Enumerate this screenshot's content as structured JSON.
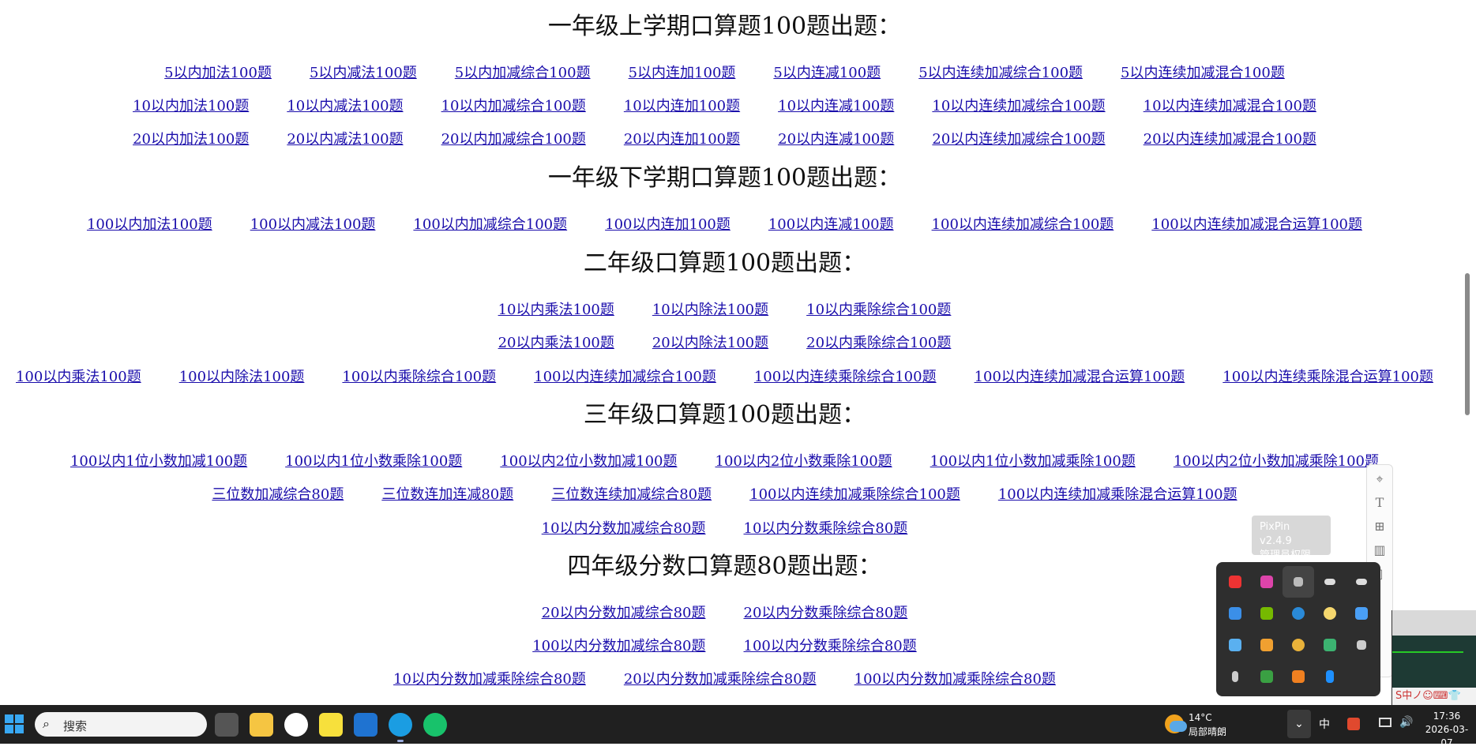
{
  "sections": [
    {
      "title": "一年级上学期口算题100题出题：",
      "rows": [
        [
          "5以内加法100题",
          "5以内减法100题",
          "5以内加减综合100题",
          "5以内连加100题",
          "5以内连减100题",
          "5以内连续加减综合100题",
          "5以内连续加减混合100题"
        ],
        [
          "10以内加法100题",
          "10以内减法100题",
          "10以内加减综合100题",
          "10以内连加100题",
          "10以内连减100题",
          "10以内连续加减综合100题",
          "10以内连续加减混合100题"
        ],
        [
          "20以内加法100题",
          "20以内减法100题",
          "20以内加减综合100题",
          "20以内连加100题",
          "20以内连减100题",
          "20以内连续加减综合100题",
          "20以内连续加减混合100题"
        ]
      ]
    },
    {
      "title": "一年级下学期口算题100题出题：",
      "rows": [
        [
          "100以内加法100题",
          "100以内减法100题",
          "100以内加减综合100题",
          "100以内连加100题",
          "100以内连减100题",
          "100以内连续加减综合100题",
          "100以内连续加减混合运算100题"
        ]
      ]
    },
    {
      "title": "二年级口算题100题出题：",
      "rows": [
        [
          "10以内乘法100题",
          "10以内除法100题",
          "10以内乘除综合100题"
        ],
        [
          "20以内乘法100题",
          "20以内除法100题",
          "20以内乘除综合100题"
        ],
        [
          "100以内乘法100题",
          "100以内除法100题",
          "100以内乘除综合100题",
          "100以内连续加减综合100题",
          "100以内连续乘除综合100题",
          "100以内连续加减混合运算100题",
          "100以内连续乘除混合运算100题"
        ]
      ]
    },
    {
      "title": "三年级口算题100题出题：",
      "rows": [
        [
          "100以内1位小数加减100题",
          "100以内1位小数乘除100题",
          "100以内2位小数加减100题",
          "100以内2位小数乘除100题",
          "100以内1位小数加减乘除100题",
          "100以内2位小数加减乘除100题"
        ],
        [
          "三位数加减综合80题",
          "三位数连加连减80题",
          "三位数连续加减综合80题",
          "100以内连续加减乘除综合100题",
          "100以内连续加减乘除混合运算100题"
        ],
        [
          "10以内分数加减综合80题",
          "10以内分数乘除综合80题"
        ]
      ]
    },
    {
      "title": "四年级分数口算题80题出题：",
      "rows": [
        [
          "20以内分数加减综合80题",
          "20以内分数乘除综合80题"
        ],
        [
          "100以内分数加减综合80题",
          "100以内分数乘除综合80题"
        ],
        [
          "10以内分数加减乘除综合80题",
          "20以内分数加减乘除综合80题",
          "100以内分数加减乘除综合80题"
        ]
      ]
    }
  ],
  "pixpin": {
    "tooltip_line1": "PixPin v2.4.9",
    "tooltip_line2": "管理员权限"
  },
  "side_app": {
    "ime_text": "S中ノ☺⌨👕"
  },
  "taskbar": {
    "search_placeholder": "搜索",
    "weather_temp": "14°C",
    "weather_desc": "局部晴朗",
    "ime_indicator": "中",
    "tray_chevron": "⌄",
    "time": "17:36",
    "date": "2026-03-07"
  },
  "colors": {
    "link": "#1a0dab",
    "taskbar": "#202020",
    "tray_popup": "#2e2e2e"
  }
}
